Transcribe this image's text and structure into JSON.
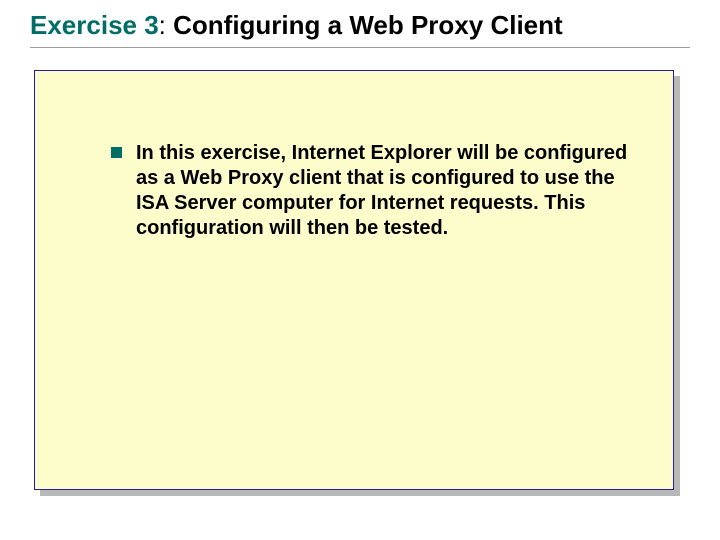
{
  "title": {
    "exercise_label": "Exercise 3",
    "separator": ": ",
    "rest": "Configuring a Web Proxy Client"
  },
  "bullets": [
    {
      "text": "In this exercise, Internet Explorer will be configured as a Web Proxy client that is configured to use the ISA Server computer for Internet requests. This configuration will then be tested."
    }
  ],
  "colors": {
    "accent": "#006d66",
    "panel_bg": "#fdfccb",
    "panel_border": "#2b1aa0",
    "shadow": "#b8b8b8"
  }
}
